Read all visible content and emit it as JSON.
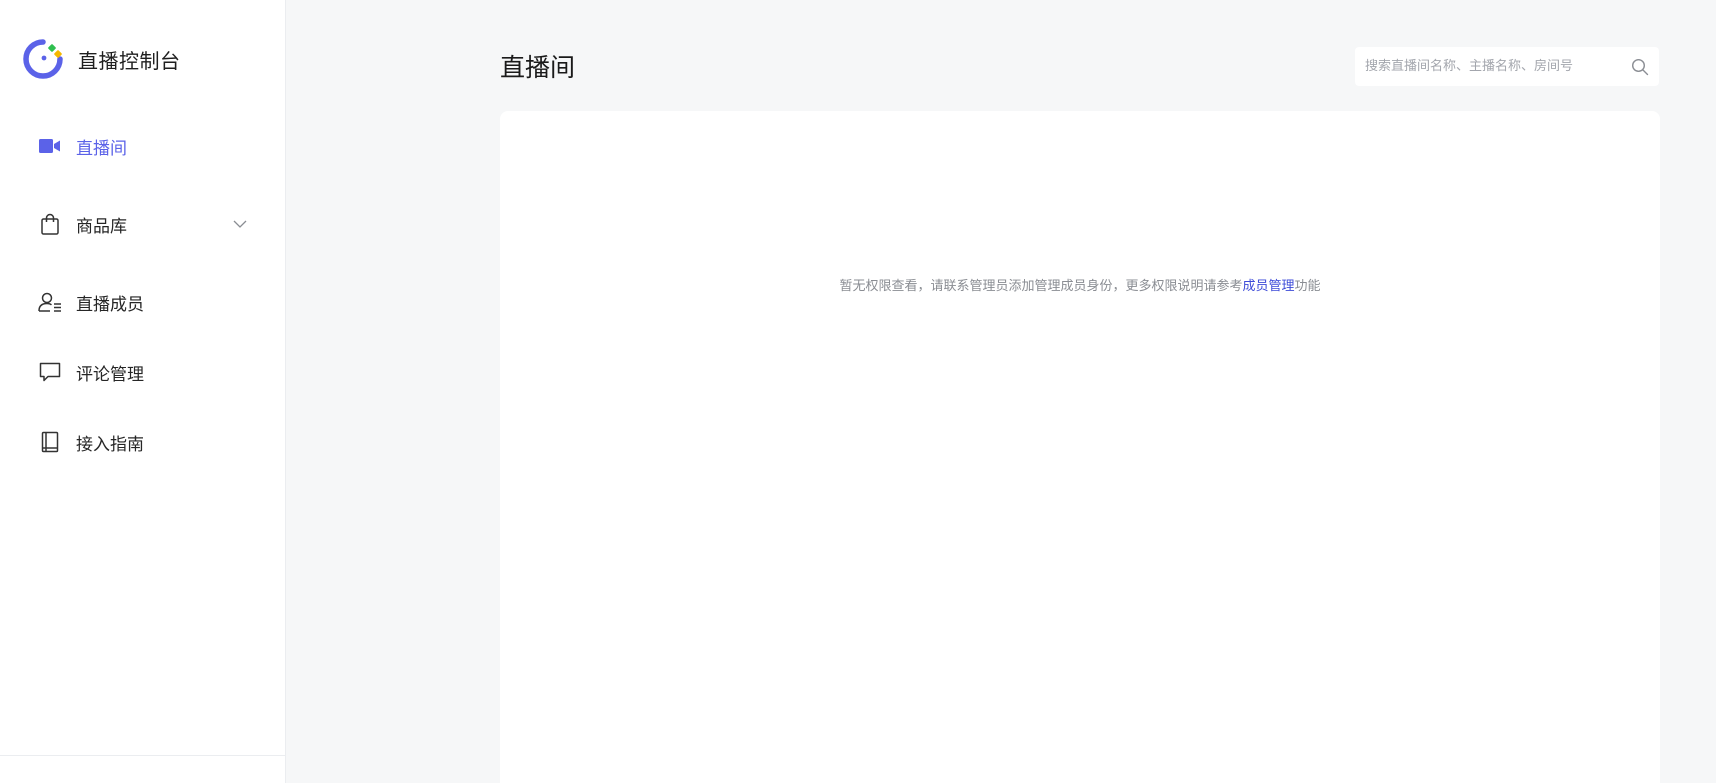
{
  "sidebar": {
    "brand_title": "直播控制台",
    "items": [
      {
        "label": "直播间",
        "icon": "video-camera-icon",
        "active": true
      },
      {
        "label": "商品库",
        "icon": "shopping-bag-icon",
        "expandable": true
      },
      {
        "label": "直播成员",
        "icon": "user-list-icon"
      },
      {
        "label": "评论管理",
        "icon": "comment-icon"
      },
      {
        "label": "接入指南",
        "icon": "book-icon"
      }
    ]
  },
  "header": {
    "title": "直播间"
  },
  "search": {
    "placeholder": "搜索直播间名称、主播名称、房间号",
    "value": ""
  },
  "empty_state": {
    "message_before": "暂无权限查看，请联系管理员添加管理成员身份，更多权限说明请参考",
    "link_text": "成员管理",
    "message_after": "功能"
  },
  "colors": {
    "accent": "#5b62e8",
    "link": "#3d4bd8",
    "logo_green": "#2fbf4f",
    "logo_yellow": "#f5b800",
    "background": "#f6f7f8"
  }
}
